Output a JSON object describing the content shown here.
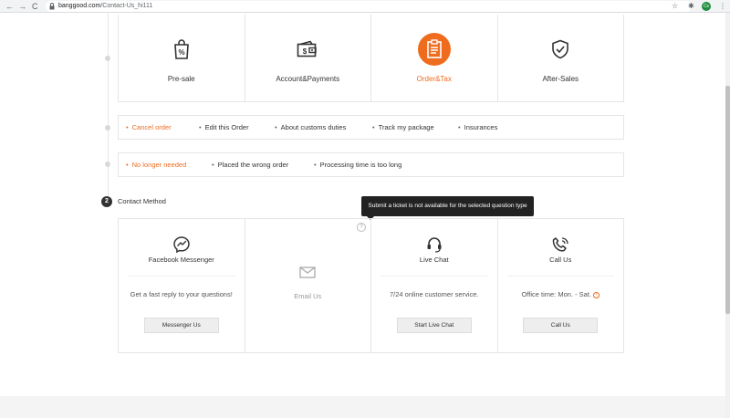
{
  "browser": {
    "url_domain": "banggood.com",
    "url_path": "/Contact-Us_hi111",
    "profile_initials": "Cs",
    "back": "←",
    "forward": "→",
    "reload": "C",
    "star": "☆",
    "extensions": "✱",
    "menu": "⋮",
    "lock": "🔒"
  },
  "categories": [
    {
      "label": "Pre-sale",
      "icon": "shopping-bag-percent-icon",
      "active": false
    },
    {
      "label": "Account&Payments",
      "icon": "wallet-icon",
      "active": false
    },
    {
      "label": "Order&Tax",
      "icon": "clipboard-icon",
      "active": true
    },
    {
      "label": "After-Sales",
      "icon": "shield-check-icon",
      "active": false
    }
  ],
  "order_options": [
    {
      "label": "Cancel order",
      "active": true
    },
    {
      "label": "Edit this Order",
      "active": false
    },
    {
      "label": "About customs duties",
      "active": false
    },
    {
      "label": "Track my package",
      "active": false
    },
    {
      "label": "Insurances",
      "active": false
    }
  ],
  "reason_options": [
    {
      "label": "No longer needed",
      "active": true
    },
    {
      "label": "Placed the wrong order",
      "active": false
    },
    {
      "label": "Processing time is too long",
      "active": false
    }
  ],
  "bullet": "•",
  "contact": {
    "step": "2",
    "title": "Contact Method",
    "tooltip": "Submit a ticket is not available for the selected question type",
    "help": "?",
    "info": "!",
    "methods": [
      {
        "title": "Facebook Messenger",
        "icon": "messenger-icon",
        "desc": "Get a fast reply to your questions!",
        "button": "Messenger Us"
      },
      {
        "title": "Email Us",
        "icon": "envelope-icon",
        "disabled": true
      },
      {
        "title": "Live Chat",
        "icon": "headset-icon",
        "desc": "7/24 online customer service.",
        "button": "Start Live Chat"
      },
      {
        "title": "Call Us",
        "icon": "phone-icon",
        "desc": "Office time: Mon. - Sat.",
        "button": "Call Us"
      }
    ]
  },
  "colors": {
    "accent": "#ef6c1f"
  }
}
